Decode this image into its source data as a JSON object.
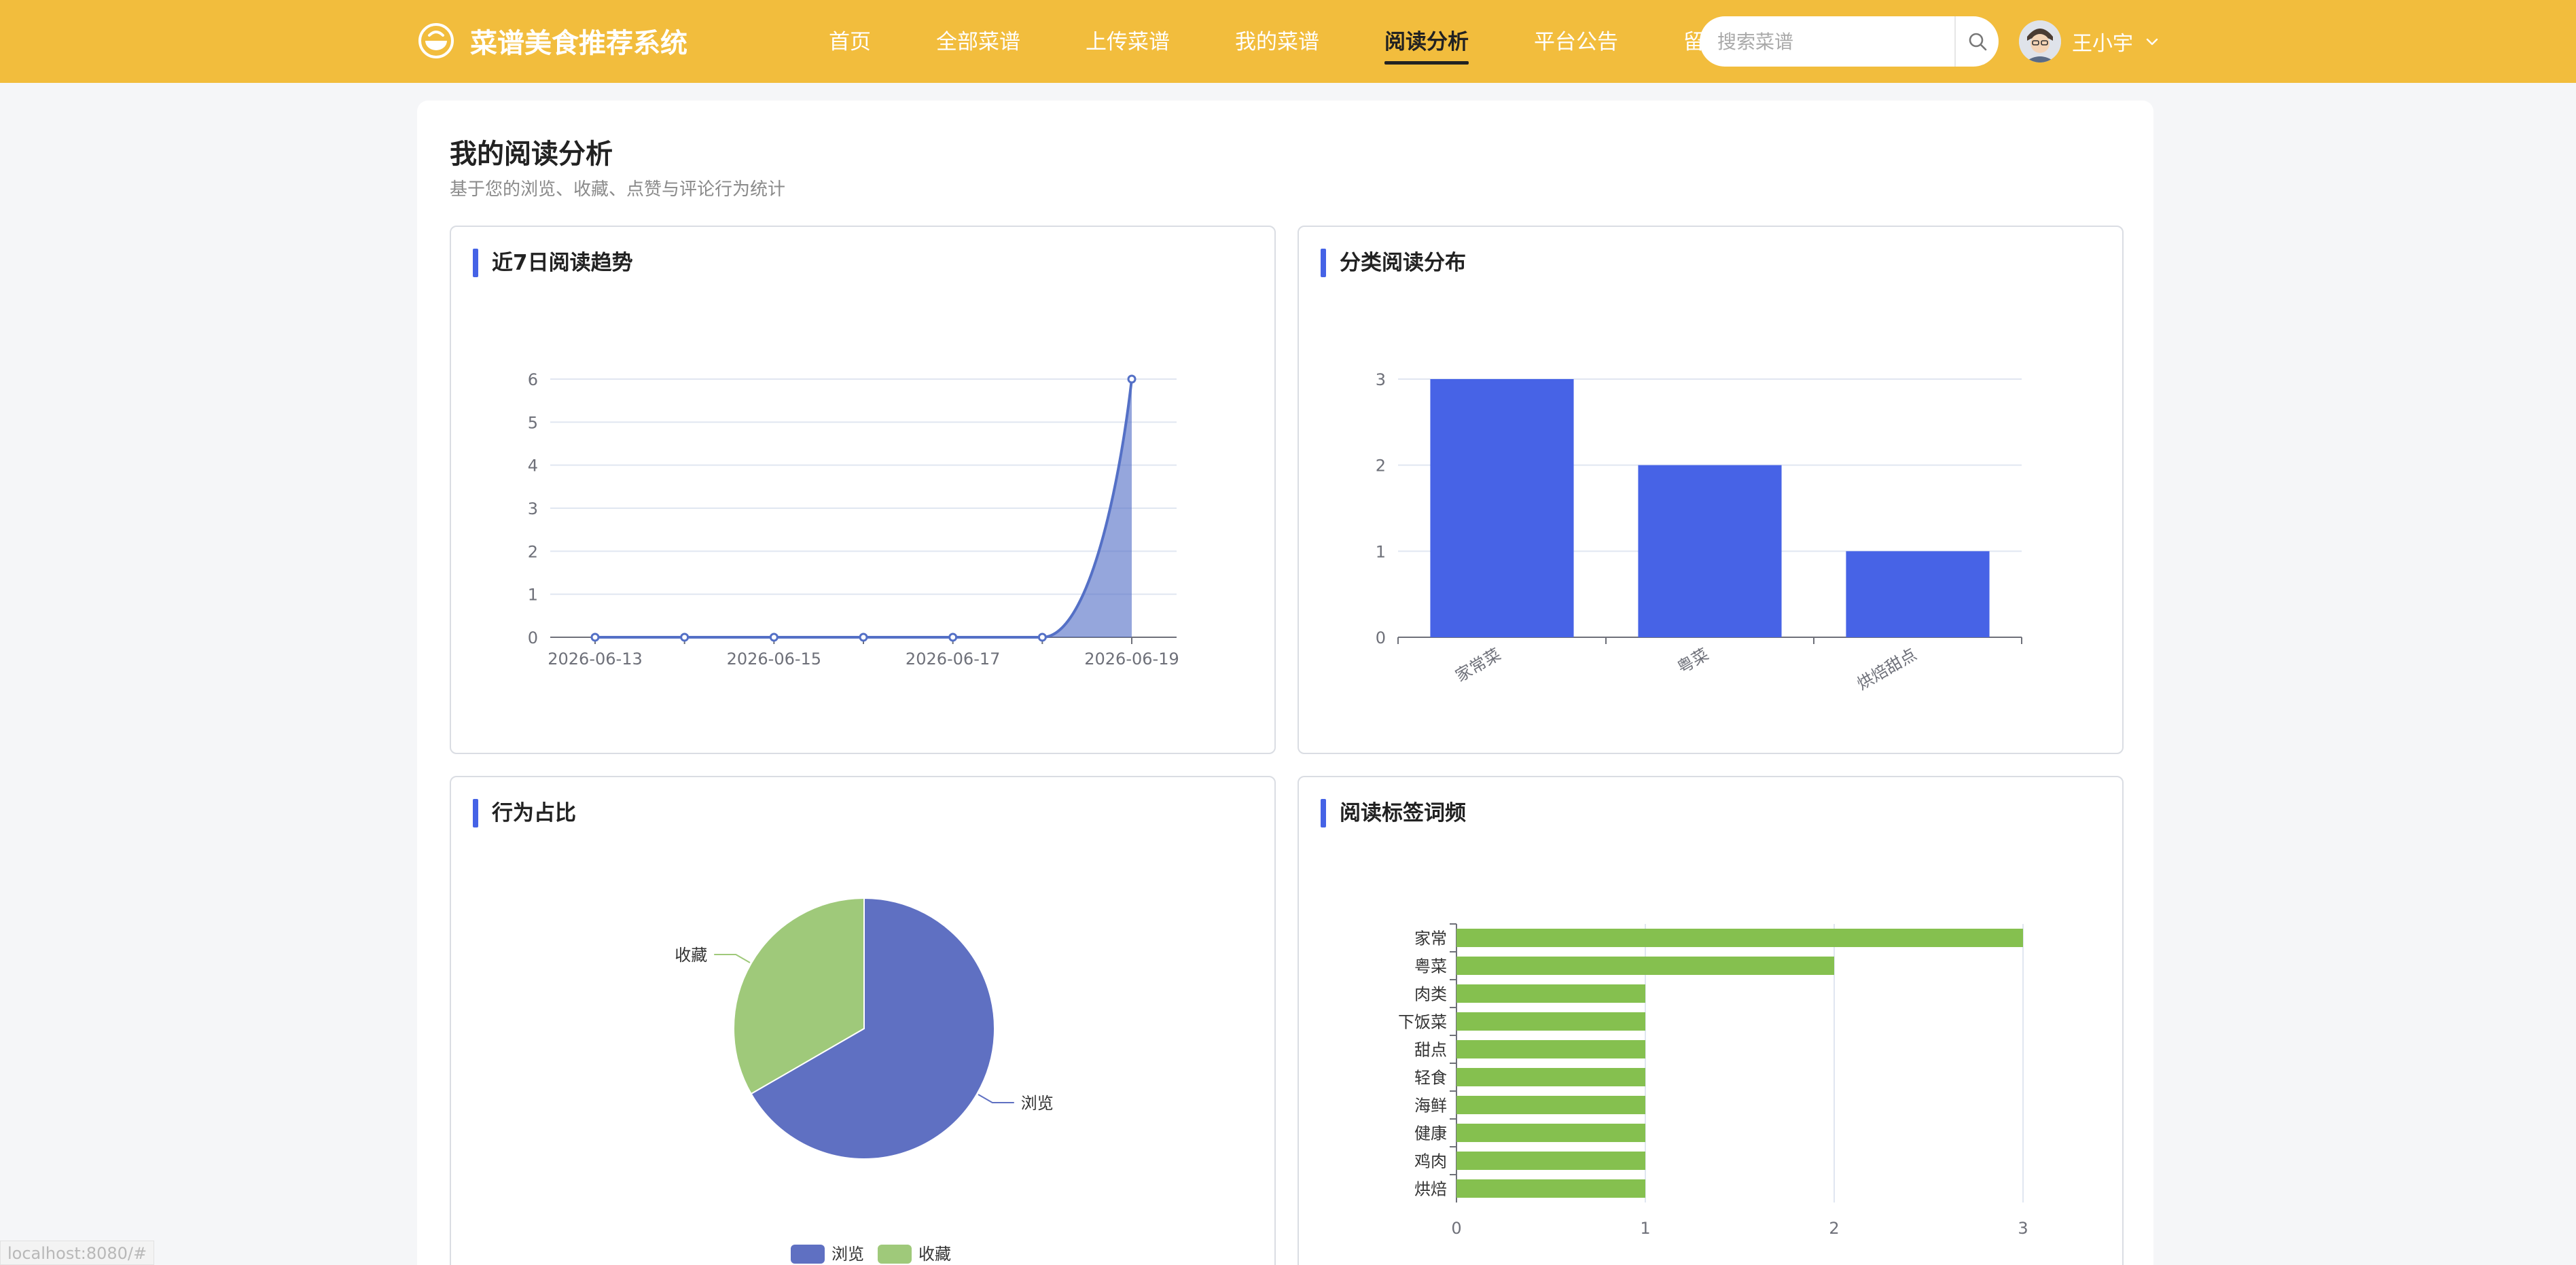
{
  "header": {
    "app_title": "菜谱美食推荐系统",
    "nav": [
      {
        "label": "首页"
      },
      {
        "label": "全部菜谱"
      },
      {
        "label": "上传菜谱"
      },
      {
        "label": "我的菜谱"
      },
      {
        "label": "阅读分析",
        "active": true
      },
      {
        "label": "平台公告"
      },
      {
        "label": "留言反馈"
      }
    ],
    "search_placeholder": "搜索菜谱",
    "search_value": "",
    "user_name": "王小宇",
    "icons": {
      "logo": "bowl-icon",
      "search": "search-icon",
      "dropdown": "chevron-down-icon"
    },
    "colors": {
      "bar": "#f2bd3d",
      "text": "#ffffff"
    }
  },
  "main": {
    "title": "我的阅读分析",
    "subtitle": "基于您的浏览、收藏、点赞与评论行为统计"
  },
  "panels": [
    {
      "title": "近7日阅读趋势"
    },
    {
      "title": "分类阅读分布"
    },
    {
      "title": "行为占比"
    },
    {
      "title": "阅读标签词频"
    }
  ],
  "chart_data": [
    {
      "type": "area",
      "x": [
        "2026-06-13",
        "2026-06-14",
        "2026-06-15",
        "2026-06-16",
        "2026-06-17",
        "2026-06-18",
        "2026-06-19"
      ],
      "x_tick_labels": [
        "2026-06-13",
        "2026-06-15",
        "2026-06-17",
        "2026-06-19"
      ],
      "values": [
        0,
        0,
        0,
        0,
        0,
        0,
        6
      ],
      "ylim": [
        0,
        6
      ],
      "y_ticks": [
        0,
        1,
        2,
        3,
        4,
        5,
        6
      ],
      "grid": true,
      "smooth": true,
      "color": "#5470c6"
    },
    {
      "type": "bar",
      "categories": [
        "家常菜",
        "粤菜",
        "烘焙甜点"
      ],
      "values": [
        3,
        2,
        1
      ],
      "ylim": [
        0,
        3
      ],
      "y_ticks": [
        0,
        1,
        2,
        3
      ],
      "grid": true,
      "color": "#4763e6"
    },
    {
      "type": "pie",
      "slices": [
        {
          "name": "浏览",
          "value": 2,
          "color": "#5f70c2"
        },
        {
          "name": "收藏",
          "value": 1,
          "color": "#9fc97a"
        }
      ],
      "legend": [
        "浏览",
        "收藏"
      ],
      "legend_position": "bottom"
    },
    {
      "type": "bar",
      "orientation": "horizontal",
      "categories": [
        "家常",
        "粤菜",
        "肉类",
        "下饭菜",
        "甜点",
        "轻食",
        "海鲜",
        "健康",
        "鸡肉",
        "烘焙"
      ],
      "values": [
        3,
        2,
        1,
        1,
        1,
        1,
        1,
        1,
        1,
        1
      ],
      "xlim": [
        0,
        3
      ],
      "x_ticks": [
        0,
        1,
        2,
        3
      ],
      "grid": true,
      "color": "#85c04f"
    }
  ],
  "status_url": "localhost:8080/#"
}
